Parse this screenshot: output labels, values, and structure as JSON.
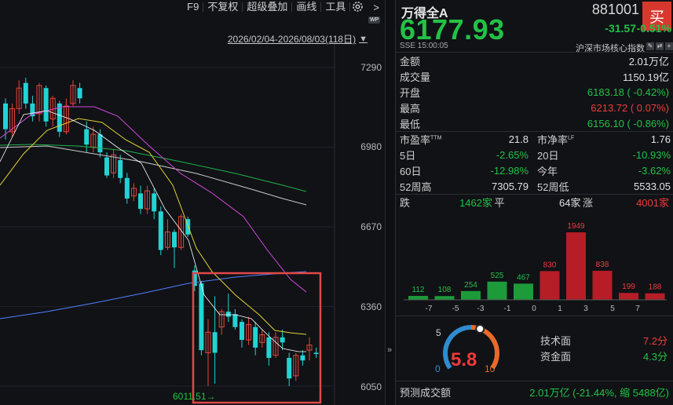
{
  "toolbar": {
    "items": [
      "F9",
      "不复权",
      "超级叠加",
      "画线",
      "工具"
    ],
    "more_arrow": ">",
    "badge": "WP"
  },
  "chart": {
    "date_range": "2026/02/04-2026/08/03(118日)",
    "y_ticks": [
      "7290",
      "6980",
      "6670",
      "6360",
      "6050"
    ],
    "low_marker": "6011.51→",
    "colors": {
      "up": "#e8433a",
      "down": "#22d3d4",
      "highlight": "#e04848",
      "ma5": "#ffffff",
      "ma10": "#e6d234",
      "ma20": "#d547d8",
      "ma30": "#22b04a",
      "ma60": "#c9c9c9",
      "ma120": "#5080ff"
    }
  },
  "quote": {
    "name": "万得全A",
    "code": "881001",
    "buy_label": "买",
    "price": "6177.93",
    "change": "-31.57",
    "change_pct": "-0.51%",
    "exchange_time": "SSE  15:00:05",
    "index_tag": "沪深市场核心指数",
    "rows": [
      {
        "label": "金额",
        "value": "2.01万亿",
        "color": "white"
      },
      {
        "label": "成交量",
        "value": "1150.19亿",
        "color": "white"
      },
      {
        "label": "开盘",
        "value": "6183.18 ( -0.42%)",
        "color": "green"
      },
      {
        "label": "最高",
        "value": "6213.72 ( 0.07%)",
        "color": "red"
      },
      {
        "label": "最低",
        "value": "6156.10 ( -0.86%)",
        "color": "green"
      }
    ],
    "grid": [
      {
        "l1": "市盈率",
        "l1sup": "TTM",
        "v1": "21.8",
        "c1": "white",
        "l2": "市净率",
        "l2sup": "LF",
        "v2": "1.76",
        "c2": "white"
      },
      {
        "l1": "5日",
        "l1sup": "",
        "v1": "-2.65%",
        "c1": "green",
        "l2": "20日",
        "l2sup": "",
        "v2": "-10.93%",
        "c2": "green"
      },
      {
        "l1": "60日",
        "l1sup": "",
        "v1": "-12.98%",
        "c1": "green",
        "l2": "今年",
        "l2sup": "",
        "v2": "-3.62%",
        "c2": "green"
      },
      {
        "l1": "52周高",
        "l1sup": "",
        "v1": "7305.79",
        "c1": "white",
        "l2": "52周低",
        "l2sup": "",
        "v2": "5533.05",
        "c2": "white"
      }
    ],
    "breadth": {
      "down_label": "跌",
      "down_value": "1462家",
      "flat_label": "平",
      "flat_value": "64家",
      "up_label": "涨",
      "up_value": "4001家"
    },
    "score": {
      "value": "5.8",
      "min": "0",
      "mid": "5",
      "max": "10",
      "fraction": 0.58,
      "tech_label": "技术面",
      "tech_value": "7.2分",
      "fund_label": "资金面",
      "fund_value": "4.3分"
    },
    "forecast": {
      "label": "预测成交额",
      "value": "2.01万亿 (-21.44%, 缩 5488亿)"
    }
  },
  "chart_data": {
    "type": "bar",
    "categories": [
      "-7",
      "-5",
      "-3",
      "-1",
      "0",
      "1",
      "3",
      "5",
      "7"
    ],
    "values": [
      112,
      108,
      254,
      525,
      467,
      830,
      1949,
      838,
      199,
      188
    ],
    "bar_colors": [
      "green",
      "green",
      "green",
      "green",
      "green",
      "red",
      "red",
      "red",
      "red",
      "red"
    ]
  }
}
